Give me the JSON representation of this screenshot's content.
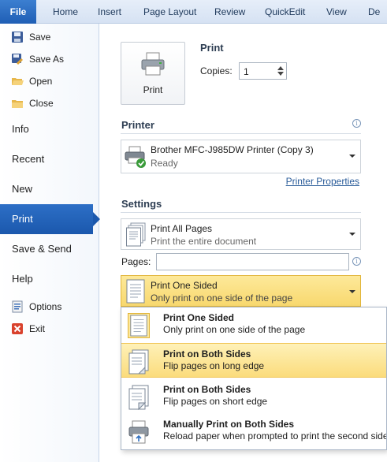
{
  "ribbon": {
    "file_tab": "File",
    "tabs": [
      "Home",
      "Insert",
      "Page Layout",
      "Review",
      "QuickEdit",
      "View",
      "De"
    ]
  },
  "nav": {
    "commands_top": [
      {
        "label": "Save",
        "icon": "save-icon"
      },
      {
        "label": "Save As",
        "icon": "save-as-icon"
      },
      {
        "label": "Open",
        "icon": "folder-open-icon"
      },
      {
        "label": "Close",
        "icon": "folder-close-icon"
      }
    ],
    "tabs": [
      "Info",
      "Recent",
      "New",
      "Print",
      "Save & Send",
      "Help"
    ],
    "active_tab": "Print",
    "commands_bottom": [
      {
        "label": "Options",
        "icon": "options-icon"
      },
      {
        "label": "Exit",
        "icon": "exit-icon"
      }
    ]
  },
  "print": {
    "heading": "Print",
    "button_label": "Print",
    "copies_label": "Copies:",
    "copies_value": "1"
  },
  "printer": {
    "heading": "Printer",
    "name": "Brother MFC-J985DW Printer (Copy 3)",
    "status": "Ready",
    "properties_link": "Printer Properties"
  },
  "settings": {
    "heading": "Settings",
    "range_title": "Print All Pages",
    "range_desc": "Print the entire document",
    "pages_label": "Pages:",
    "pages_value": "",
    "sided_title": "Print One Sided",
    "sided_desc": "Only print on one side of the page"
  },
  "sided_options": [
    {
      "title": "Print One Sided",
      "desc": "Only print on one side of the page"
    },
    {
      "title": "Print on Both Sides",
      "desc": "Flip pages on long edge"
    },
    {
      "title": "Print on Both Sides",
      "desc": "Flip pages on short edge"
    },
    {
      "title": "Manually Print on Both Sides",
      "desc": "Reload paper when prompted to print the second side"
    }
  ],
  "colors": {
    "accent": "#1b58ad",
    "highlight": "#fbdc7c",
    "ribbon": "#d6e2f3"
  }
}
